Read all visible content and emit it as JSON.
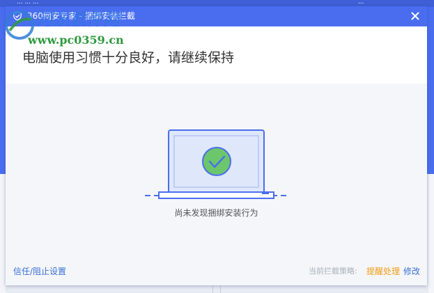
{
  "background_app": {
    "top_left_text": "... ... ...",
    "top_right_text": "...",
    "colors": {
      "band": "#4a6df0",
      "content": "#e7ebf2"
    }
  },
  "dialog": {
    "title": "360网安专家 - 捆绑安装拦截",
    "title_icon": "shield-icon",
    "close_icon": "close-icon",
    "headline": "电脑使用习惯十分良好，请继续保持",
    "illustration_icon": "laptop-check-icon",
    "status": "尚未发现捆绑安装行为",
    "footer": {
      "trust_block_settings": "信任/阻止设置",
      "policy_label": "当前拦截策略:",
      "policy_value": "提醒处理",
      "modify": "修改"
    },
    "colors": {
      "titlebar": "#4a6df0",
      "link": "#3a6fd6",
      "policy_value": "#f39c12",
      "check_green": "#6cc66c",
      "screen": "#dfe7fb"
    }
  },
  "watermark": {
    "url": "www.pc0359.cn",
    "logo_icon": "site-logo-icon"
  }
}
